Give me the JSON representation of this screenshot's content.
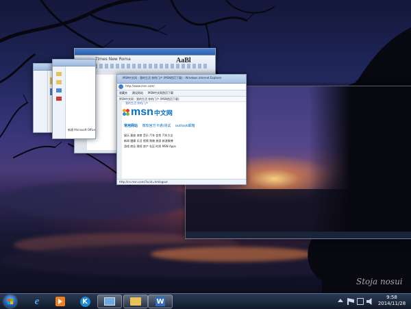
{
  "wps_window": {
    "ribbon_tab": "Times New Roma",
    "font_size_preview": "AaBl"
  },
  "ie_window": {
    "title": "MSN中文网 - 我的生活 你的门户 (MSN首页下载) - Windows Internet Explorer",
    "tab_label": "MSN中文网 - 我的生活 你的门户 (MSN首页下载)",
    "address": "http://www.msn.com/",
    "favorites": [
      "收藏夹",
      "建议网站",
      "MSN中文网首页下载"
    ],
    "banner_tagline": "我的生活 你的门户",
    "logo_text": "msn",
    "logo_suffix": "中文网",
    "nav_links": [
      "常用网站",
      "微软官方卡通/测试",
      "outlook邮箱"
    ],
    "link_rows": [
      [
        "娱乐",
        "星座",
        "体育",
        "音乐",
        "汽车",
        "女性",
        "汽车大全"
      ],
      [
        "新闻",
        "健康",
        "乐活",
        "视频",
        "购物",
        "旅游",
        "新浪微博"
      ],
      [
        "游戏",
        "商业",
        "财经",
        "房产",
        "社区",
        "时尚",
        "MSN Apps"
      ]
    ],
    "status_url": "http://cn.msn.com/?ocid=hmlogout"
  },
  "explorer_window": {
    "items": [
      "新建 Microsoft Office",
      "新建 Microsoft Office"
    ]
  },
  "desktop": {
    "signature": "Stoja nosui"
  },
  "taskbar": {
    "start_icon": "windows-orb-icon",
    "apps": [
      {
        "name": "internet-explorer-icon",
        "color": "#3a8ee6"
      },
      {
        "name": "media-player-icon",
        "color": "#f07f1f"
      },
      {
        "name": "kugou-icon",
        "color": "#1f8ad6"
      },
      {
        "name": "remote-desktop-icon",
        "color": "#6fa8dc"
      },
      {
        "name": "file-explorer-icon",
        "color": "#e8c15a"
      },
      {
        "name": "wps-writer-icon",
        "color": "#2f6cc2"
      }
    ],
    "tray": {
      "time": "9:58",
      "date": "2014/11/28"
    }
  }
}
